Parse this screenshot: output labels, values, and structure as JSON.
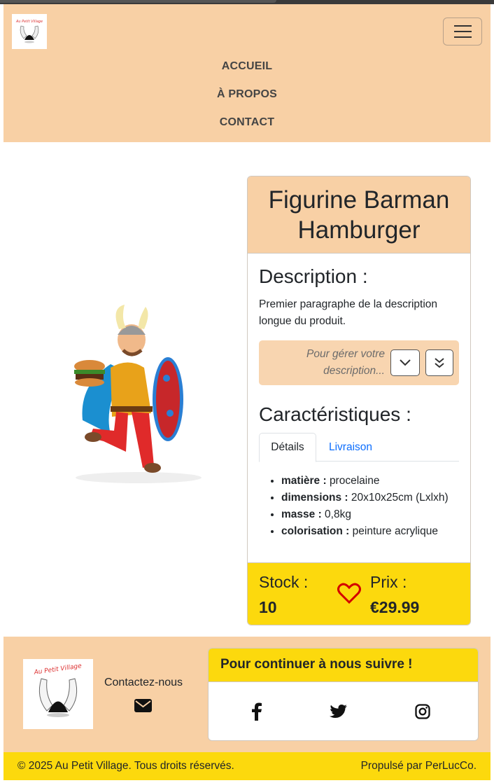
{
  "nav": {
    "logo_text": "Au Petit Village",
    "toggle_icon": "hamburger-menu-icon",
    "items": [
      {
        "label": "ACCUEIL"
      },
      {
        "label": "À PROPOS"
      },
      {
        "label": "CONTACT"
      }
    ]
  },
  "product": {
    "title": "Figurine Barman Hamburger",
    "description_title": "Description :",
    "description_text": "Premier paragraphe de la description longue du produit.",
    "manage_text": "Pour gérer votre description...",
    "characteristics_title": "Caractéristiques :",
    "tabs": [
      {
        "label": "Détails"
      },
      {
        "label": "Livraison"
      }
    ],
    "specs": [
      {
        "key": "matière :",
        "value": "procelaine"
      },
      {
        "key": "dimensions :",
        "value": "20x10x25cm (Lxlxh)"
      },
      {
        "key": "masse :",
        "value": "0,8kg"
      },
      {
        "key": "colorisation :",
        "value": "peinture acrylique"
      }
    ],
    "stock_label": "Stock :",
    "stock_value": "10",
    "price_label": "Prix :",
    "price_value": "€29.99"
  },
  "footer": {
    "logo_text": "Au Petit Village",
    "contact_label": "Contactez-nous",
    "follow_title": "Pour continuer à nous suivre !",
    "social": [
      "facebook-icon",
      "twitter-icon",
      "instagram-icon"
    ],
    "copyright": "© 2025 Au Petit Village. Tous droits réservés.",
    "powered_by": "Propulsé par PerLucCo."
  },
  "colors": {
    "peach": "#f8d0a5",
    "yellow": "#fcd90d",
    "heart": "#d40000",
    "link": "#0d6efd"
  }
}
